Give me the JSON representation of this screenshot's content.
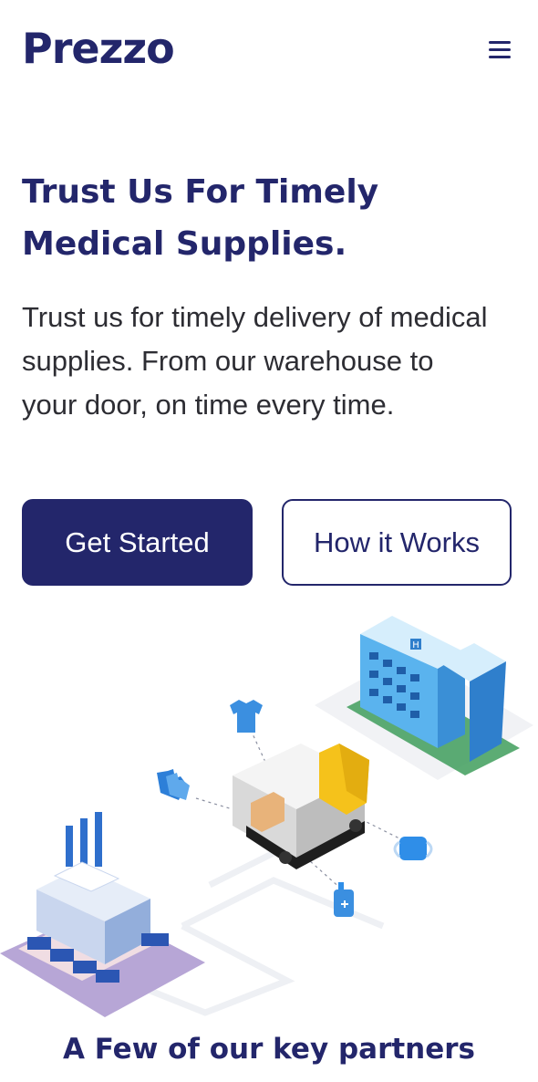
{
  "header": {
    "logo": "Prezzo",
    "menu_icon": "hamburger-menu-icon"
  },
  "hero": {
    "title": "Trust Us For Timely Medical Supplies.",
    "description": "Trust us for timely delivery of medical supplies. From our warehouse to your door, on time every time.",
    "primary_button": "Get Started",
    "secondary_button": "How it Works"
  },
  "illustration": {
    "icons": [
      "hospital-icon",
      "factory-icon",
      "delivery-truck-icon",
      "shirt-icon",
      "gloves-icon",
      "face-mask-icon",
      "sanitizer-bottle-icon"
    ],
    "building_sign": "H"
  },
  "partners": {
    "heading": "A Few of our key partners"
  },
  "colors": {
    "brand": "#23266b",
    "text": "#2d2d33",
    "accent_blue": "#2f8ee8",
    "truck_yellow": "#f5c21b"
  }
}
